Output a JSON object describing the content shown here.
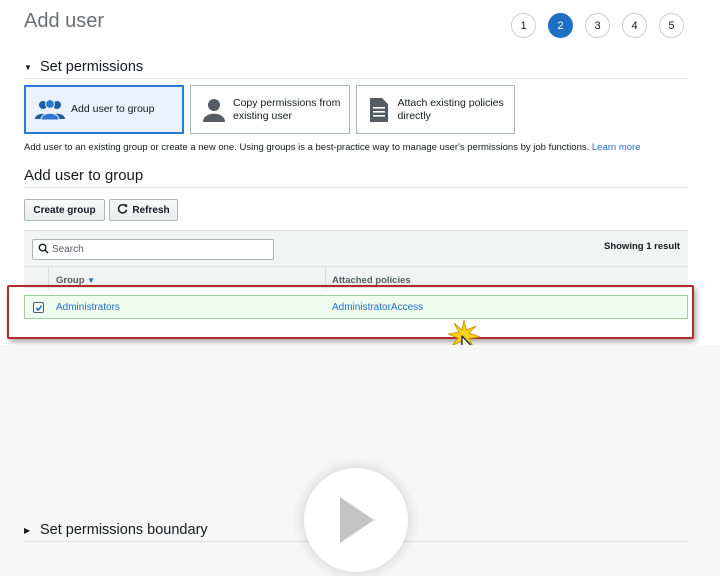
{
  "page": {
    "title": "Add user"
  },
  "steps": [
    "1",
    "2",
    "3",
    "4",
    "5"
  ],
  "active_step": "2",
  "permissions": {
    "section_title": "Set permissions",
    "options": [
      {
        "label": "Add user to group",
        "icon": "users-group-icon",
        "selected": true
      },
      {
        "label": "Copy permissions from existing user",
        "icon": "user-icon",
        "selected": false
      },
      {
        "label": "Attach existing policies directly",
        "icon": "document-icon",
        "selected": false
      }
    ],
    "description": "Add user to an existing group or create a new one. Using groups is a best-practice way to manage user's permissions by job functions.",
    "learn_more": "Learn more"
  },
  "group": {
    "title": "Add user to group",
    "create_button": "Create group",
    "refresh_button": "Refresh",
    "search_placeholder": "Search",
    "result_count": "Showing 1 result",
    "columns": [
      "Group",
      "Attached policies"
    ],
    "rows": [
      {
        "group": "Administrators",
        "policies": "AdministratorAccess",
        "checked": true
      }
    ]
  },
  "boundary": {
    "section_title": "Set permissions boundary"
  },
  "colors": {
    "accent": "#1f6fc4",
    "highlight_border": "#b22c2c",
    "row_selected": "#f0fbf0"
  }
}
